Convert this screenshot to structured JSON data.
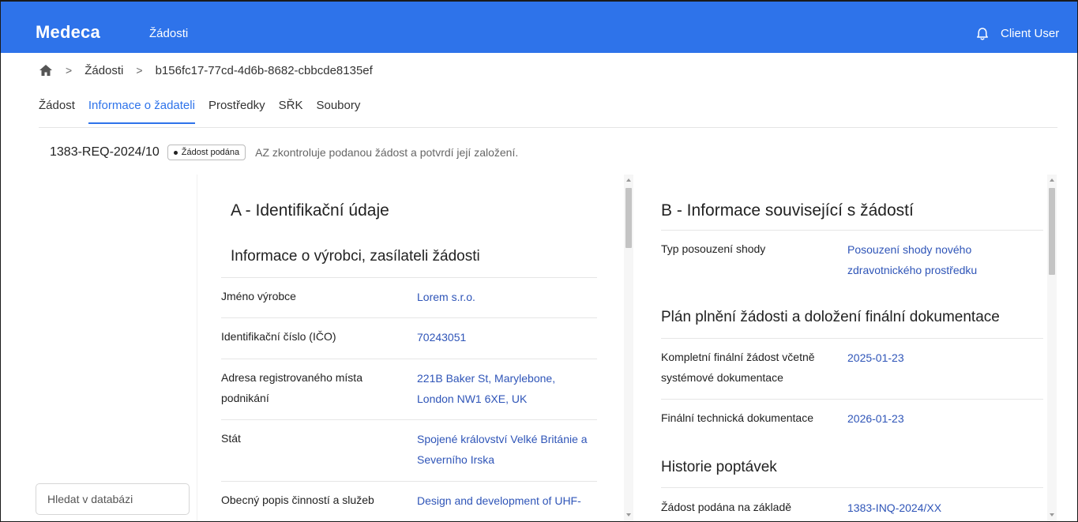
{
  "header": {
    "brand": "Medeca",
    "nav_item": "Žádosti",
    "user": "Client User"
  },
  "breadcrumb": {
    "level1": "Žádosti",
    "level2": "b156fc17-77cd-4d6b-8682-cbbcde8135ef"
  },
  "tabs": [
    {
      "label": "Žádost"
    },
    {
      "label": "Informace o žadateli"
    },
    {
      "label": "Prostředky"
    },
    {
      "label": "SŘK"
    },
    {
      "label": "Soubory"
    }
  ],
  "active_tab": "Informace o žadateli",
  "status": {
    "request_id": "1383-REQ-2024/10",
    "badge": "Žádost podána",
    "note": "AZ zkontroluje podanou žádost a potvrdí její založení."
  },
  "search": {
    "placeholder": "Hledat v databázi"
  },
  "section_a": {
    "title": "A - Identifikační údaje",
    "subtitle": "Informace o výrobci, zasílateli žádosti",
    "rows": [
      {
        "label": "Jméno výrobce",
        "value": "Lorem s.r.o."
      },
      {
        "label": "Identifikační číslo (IČO)",
        "value": "70243051"
      },
      {
        "label_l1": "Adresa registrovaného místa",
        "label_l2": "podnikání",
        "value_l1": "221B Baker St, Marylebone,",
        "value_l2": "London NW1 6XE, UK"
      },
      {
        "label": "Stát",
        "value_l1": "Spojené království Velké Británie a",
        "value_l2": "Severního Irska"
      },
      {
        "label": "Obecný popis činností a služeb",
        "value": "Design and development of UHF-"
      }
    ]
  },
  "section_b": {
    "title": "B - Informace související s žádostí",
    "row_type": {
      "label": "Typ posouzení shody",
      "value_l1": "Posouzení shody nového",
      "value_l2": "zdravotnického prostředku"
    },
    "plan_title": "Plán plnění žádosti a doložení finální dokumentace",
    "plan_rows": [
      {
        "label_l1": "Kompletní finální žádost včetně",
        "label_l2": "systémové dokumentace",
        "value": "2025-01-23"
      },
      {
        "label": "Finální technická dokumentace",
        "value": "2026-01-23"
      }
    ],
    "history_title": "Historie poptávek",
    "history_rows": [
      {
        "label": "Žádost podána na základě",
        "value": "1383-INQ-2024/XX"
      }
    ]
  },
  "colors": {
    "accent": "#2e73ea",
    "link": "#2f55b8"
  }
}
